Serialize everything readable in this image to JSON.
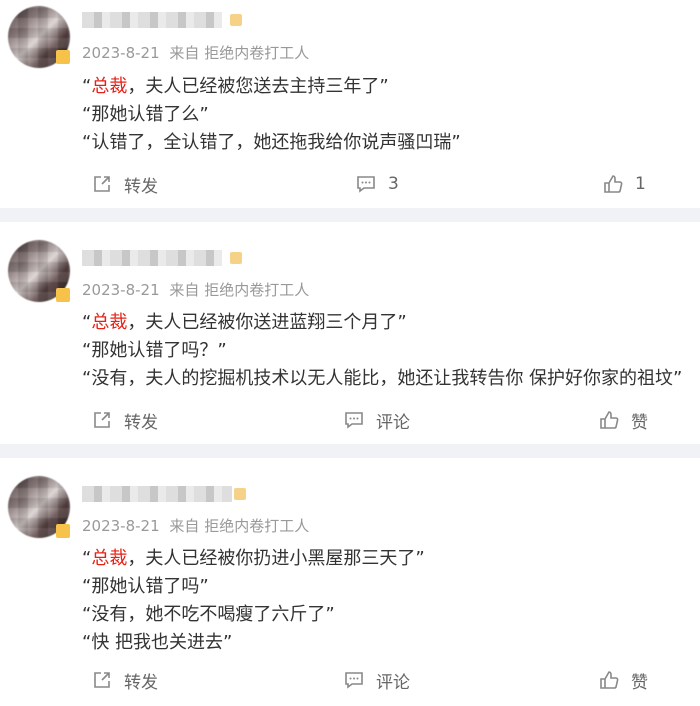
{
  "posts": [
    {
      "date": "2023-8-21",
      "source": "来自 拒绝内卷打工人",
      "lines": [
        {
          "pre": "“",
          "hl": "总裁",
          "post": "，夫人已经被您送去主持三年了”"
        },
        {
          "pre": "",
          "hl": "",
          "post": "“那她认错了么”"
        },
        {
          "pre": "",
          "hl": "",
          "post": "“认错了，全认错了，她还拖我给你说声骚凹瑞”"
        }
      ],
      "repost_label": "转发",
      "comment_label": "3",
      "like_label": "1"
    },
    {
      "date": "2023-8-21",
      "source": "来自 拒绝内卷打工人",
      "lines": [
        {
          "pre": "“",
          "hl": "总裁",
          "post": "，夫人已经被你送进蓝翔三个月了”"
        },
        {
          "pre": "",
          "hl": "",
          "post": "“那她认错了吗？”"
        },
        {
          "pre": "",
          "hl": "",
          "post": "“没有，夫人的挖掘机技术以无人能比，她还让我转告你 保护好你家的祖坟”"
        }
      ],
      "repost_label": "转发",
      "comment_label": "评论",
      "like_label": "赞"
    },
    {
      "date": "2023-8-21",
      "source": "来自 拒绝内卷打工人",
      "lines": [
        {
          "pre": "“",
          "hl": "总裁",
          "post": "，夫人已经被你扔进小黑屋那三天了”"
        },
        {
          "pre": "",
          "hl": "",
          "post": "“那她认错了吗”"
        },
        {
          "pre": "",
          "hl": "",
          "post": "“没有，她不吃不喝瘦了六斤了”"
        },
        {
          "pre": "",
          "hl": "",
          "post": "“快 把我也关进去”"
        }
      ],
      "repost_label": "转发",
      "comment_label": "评论",
      "like_label": "赞"
    }
  ],
  "colors": {
    "highlight": "#e62117",
    "meta": "#999999",
    "divider": "#f1f2f5"
  },
  "icons": {
    "repost": "share-out-icon",
    "comment": "comment-bubble-icon",
    "like": "thumbs-up-icon"
  }
}
